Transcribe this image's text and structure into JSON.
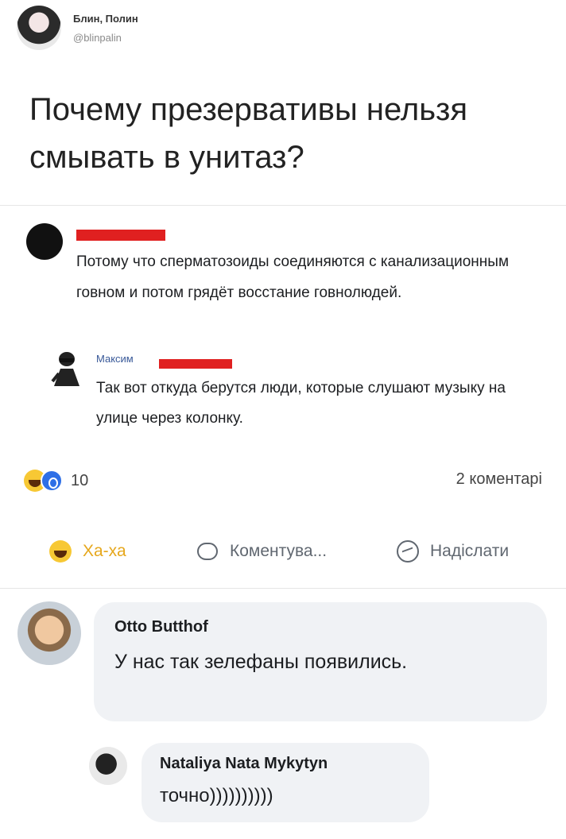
{
  "tweet": {
    "author_name": "Блин, Полин",
    "handle": "@blinpalin",
    "text": "Почему презервативы нельзя смывать в унитаз?"
  },
  "post": {
    "comment1_text": "Потому что сперматозоиды соединяются с канализационным говном и потом грядёт восстание говнолюдей.",
    "reply_author": "Максим",
    "reply_text": "Так вот откуда берутся люди, которые слушают музыку на улице через колонку.",
    "reactions_count": "10",
    "comments_count": "2 коментарі",
    "colors": {
      "redaction": "#e02020",
      "haha": "#e6a71c"
    }
  },
  "actions": {
    "haha_label": "Ха-ха",
    "comment_label": "Коментува...",
    "share_label": "Надіслати"
  },
  "thread": {
    "comment_author": "Otto Butthof",
    "comment_text": "У нас так зелефаны появились.",
    "reply_author": "Nataliya Nata Mykytyn",
    "reply_text": "точно))))))))))"
  }
}
